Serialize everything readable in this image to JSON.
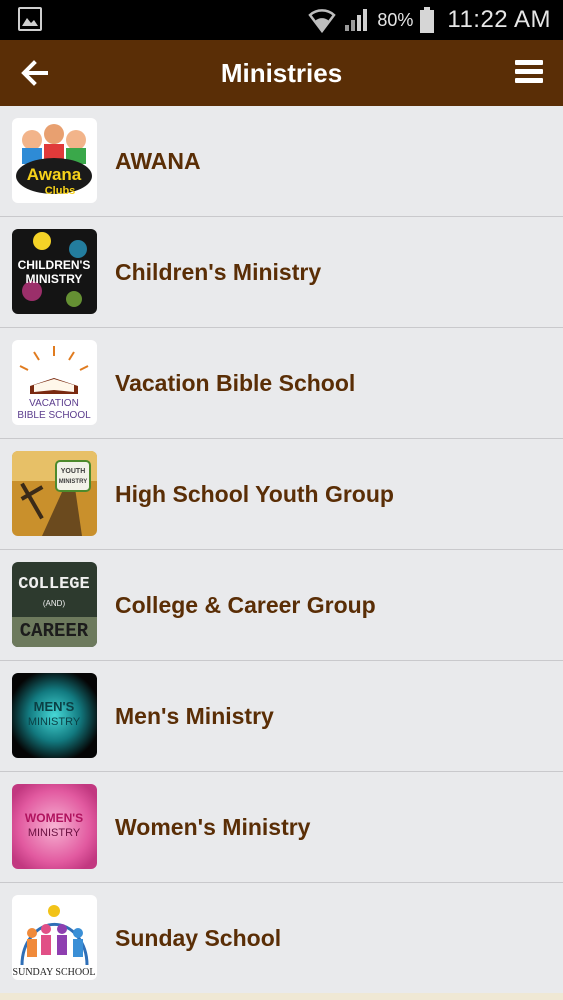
{
  "status_bar": {
    "battery_percent": "80%",
    "time": "11:22 AM"
  },
  "app_bar": {
    "title": "Ministries",
    "background": "#5a2e06"
  },
  "ministries": [
    {
      "label": "AWANA",
      "icon": "awana-clubs-logo",
      "logo_text": [
        "Awana",
        "Clubs"
      ]
    },
    {
      "label": "Children's Ministry",
      "icon": "childrens-ministry-logo",
      "logo_text": [
        "CHILDREN'S",
        "MINISTRY"
      ]
    },
    {
      "label": "Vacation Bible School",
      "icon": "vbs-open-book-logo",
      "logo_text": [
        "VACATION",
        "BIBLE SCHOOL"
      ]
    },
    {
      "label": "High School Youth Group",
      "icon": "youth-ministry-road-logo",
      "logo_text": [
        "YOUTH",
        "MINISTRY"
      ]
    },
    {
      "label": "College & Career Group",
      "icon": "college-and-career-logo",
      "logo_text": [
        "COLLEGE",
        "(AND)",
        "CAREER"
      ]
    },
    {
      "label": "Men's Ministry",
      "icon": "mens-ministry-logo",
      "logo_text": [
        "MEN'S",
        "MINISTRY"
      ]
    },
    {
      "label": "Women's Ministry",
      "icon": "womens-ministry-logo",
      "logo_text": [
        "WOMEN'S",
        "MINISTRY"
      ]
    },
    {
      "label": "Sunday School",
      "icon": "sunday-school-people-logo",
      "logo_text": [
        "SUNDAY SCHOOL"
      ]
    }
  ]
}
